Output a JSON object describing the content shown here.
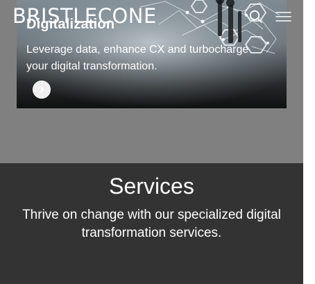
{
  "brand": {
    "logo_text": "BRISTLECONE"
  },
  "header": {
    "search_icon": "search-icon",
    "menu_icon": "hamburger-menu-icon"
  },
  "hero": {
    "title": "Digitalization",
    "description": "Leverage data, enhance CX and turbocharge your digital transformation.",
    "cta_icon": "chevron-right-icon"
  },
  "services": {
    "title": "Services",
    "description": "Thrive on change with our specialized digital transformation services."
  },
  "colors": {
    "page_gray": "#808080",
    "services_bg": "#333333",
    "text_white": "#ffffff"
  }
}
